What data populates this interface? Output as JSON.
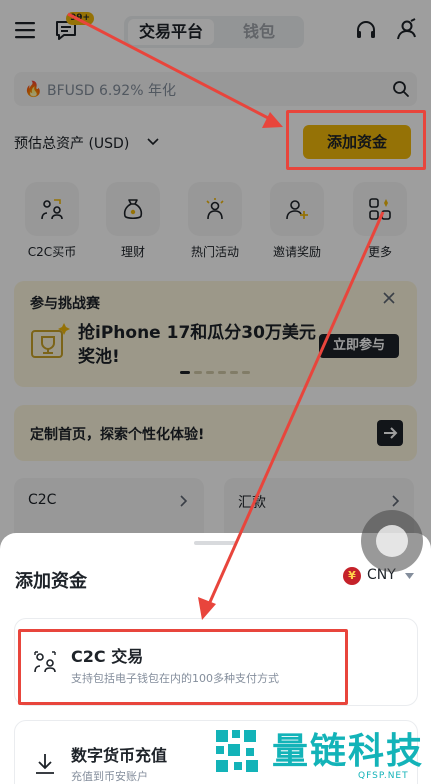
{
  "header": {
    "chat_badge": "99+",
    "tabs": [
      {
        "label": "交易平台",
        "active": true
      },
      {
        "label": "钱包",
        "active": false
      }
    ]
  },
  "search": {
    "placeholder": "BFUSD 6.92% 年化"
  },
  "assets": {
    "label": "预估总资产 (USD)",
    "add_funds_label": "添加资金"
  },
  "shortcuts": [
    {
      "label": "C2C买币",
      "icon": "c2c-icon"
    },
    {
      "label": "理财",
      "icon": "money-bag-icon"
    },
    {
      "label": "热门活动",
      "icon": "activity-icon"
    },
    {
      "label": "邀请奖励",
      "icon": "invite-icon"
    },
    {
      "label": "更多",
      "icon": "more-icon"
    }
  ],
  "promo": {
    "title": "参与挑战赛",
    "description": "抢iPhone 17和瓜分30万美元奖池!",
    "join_label": "立即参与"
  },
  "customize": {
    "text": "定制首页，探索个性化体验!"
  },
  "cards": [
    {
      "label": "C2C"
    },
    {
      "label": "汇款"
    }
  ],
  "sheet": {
    "title": "添加资金",
    "currency": "CNY",
    "currency_symbol": "¥",
    "options": [
      {
        "title": "C2C 交易",
        "description": "支持包括电子钱包在内的100多种支付方式",
        "icon": "c2c-icon"
      },
      {
        "title": "数字货币充值",
        "description": "充值到币安账户",
        "icon": "download-icon"
      }
    ]
  },
  "watermark": {
    "name": "量链科技",
    "site": "QFSP.NET"
  },
  "colors": {
    "brand_yellow": "#f0b90b",
    "annotation_red": "#e8453c",
    "watermark_teal": "#13b3b8"
  }
}
